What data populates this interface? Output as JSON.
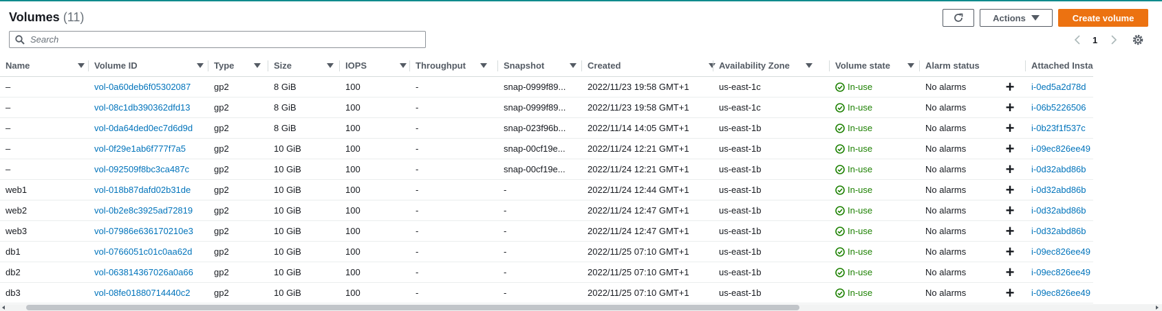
{
  "header": {
    "title": "Volumes",
    "count": "(11)"
  },
  "toolbar": {
    "actions_label": "Actions",
    "create_label": "Create volume"
  },
  "search": {
    "placeholder": "Search",
    "value": ""
  },
  "pagination": {
    "page": "1"
  },
  "table": {
    "columns": [
      "Name",
      "Volume ID",
      "Type",
      "Size",
      "IOPS",
      "Throughput",
      "Snapshot",
      "Created",
      "Availability Zone",
      "Volume state",
      "Alarm status",
      "Attached Insta"
    ],
    "rows": [
      {
        "name": "–",
        "volume_id": "vol-0a60deb6f05302087",
        "type": "gp2",
        "size": "8 GiB",
        "iops": "100",
        "throughput": "-",
        "snapshot": "snap-0999f89...",
        "created": "2022/11/23 19:58 GMT+1",
        "az": "us-east-1c",
        "state": "In-use",
        "alarm": "No alarms",
        "attached": "i-0ed5a2d78d"
      },
      {
        "name": "–",
        "volume_id": "vol-08c1db390362dfd13",
        "type": "gp2",
        "size": "8 GiB",
        "iops": "100",
        "throughput": "-",
        "snapshot": "snap-0999f89...",
        "created": "2022/11/23 19:58 GMT+1",
        "az": "us-east-1c",
        "state": "In-use",
        "alarm": "No alarms",
        "attached": "i-06b5226506"
      },
      {
        "name": "–",
        "volume_id": "vol-0da64ded0ec7d6d9d",
        "type": "gp2",
        "size": "8 GiB",
        "iops": "100",
        "throughput": "-",
        "snapshot": "snap-023f96b...",
        "created": "2022/11/14 14:05 GMT+1",
        "az": "us-east-1b",
        "state": "In-use",
        "alarm": "No alarms",
        "attached": "i-0b23f1f537c"
      },
      {
        "name": "–",
        "volume_id": "vol-0f29e1ab6f777f7a5",
        "type": "gp2",
        "size": "10 GiB",
        "iops": "100",
        "throughput": "-",
        "snapshot": "snap-00cf19e...",
        "created": "2022/11/24 12:21 GMT+1",
        "az": "us-east-1b",
        "state": "In-use",
        "alarm": "No alarms",
        "attached": "i-09ec826ee49"
      },
      {
        "name": "–",
        "volume_id": "vol-092509f8bc3ca487c",
        "type": "gp2",
        "size": "10 GiB",
        "iops": "100",
        "throughput": "-",
        "snapshot": "snap-00cf19e...",
        "created": "2022/11/24 12:21 GMT+1",
        "az": "us-east-1b",
        "state": "In-use",
        "alarm": "No alarms",
        "attached": "i-0d32abd86b"
      },
      {
        "name": "web1",
        "volume_id": "vol-018b87dafd02b31de",
        "type": "gp2",
        "size": "10 GiB",
        "iops": "100",
        "throughput": "-",
        "snapshot": "-",
        "created": "2022/11/24 12:44 GMT+1",
        "az": "us-east-1b",
        "state": "In-use",
        "alarm": "No alarms",
        "attached": "i-0d32abd86b"
      },
      {
        "name": "web2",
        "volume_id": "vol-0b2e8c3925ad72819",
        "type": "gp2",
        "size": "10 GiB",
        "iops": "100",
        "throughput": "-",
        "snapshot": "-",
        "created": "2022/11/24 12:47 GMT+1",
        "az": "us-east-1b",
        "state": "In-use",
        "alarm": "No alarms",
        "attached": "i-0d32abd86b"
      },
      {
        "name": "web3",
        "volume_id": "vol-07986e636170210e3",
        "type": "gp2",
        "size": "10 GiB",
        "iops": "100",
        "throughput": "-",
        "snapshot": "-",
        "created": "2022/11/24 12:47 GMT+1",
        "az": "us-east-1b",
        "state": "In-use",
        "alarm": "No alarms",
        "attached": "i-0d32abd86b"
      },
      {
        "name": "db1",
        "volume_id": "vol-0766051c01c0aa62d",
        "type": "gp2",
        "size": "10 GiB",
        "iops": "100",
        "throughput": "-",
        "snapshot": "-",
        "created": "2022/11/25 07:10 GMT+1",
        "az": "us-east-1b",
        "state": "In-use",
        "alarm": "No alarms",
        "attached": "i-09ec826ee49"
      },
      {
        "name": "db2",
        "volume_id": "vol-063814367026a0a66",
        "type": "gp2",
        "size": "10 GiB",
        "iops": "100",
        "throughput": "-",
        "snapshot": "-",
        "created": "2022/11/25 07:10 GMT+1",
        "az": "us-east-1b",
        "state": "In-use",
        "alarm": "No alarms",
        "attached": "i-09ec826ee49"
      },
      {
        "name": "db3",
        "volume_id": "vol-08fe01880714440c2",
        "type": "gp2",
        "size": "10 GiB",
        "iops": "100",
        "throughput": "-",
        "snapshot": "-",
        "created": "2022/11/25 07:10 GMT+1",
        "az": "us-east-1b",
        "state": "In-use",
        "alarm": "No alarms",
        "attached": "i-09ec826ee49"
      }
    ]
  },
  "icons": {
    "refresh": "refresh-icon",
    "caret": "caret-down-icon",
    "search": "search-icon",
    "prev": "chevron-left-icon",
    "next": "chevron-right-icon",
    "settings": "gear-icon",
    "sort": "sort-caret-icon",
    "status_ok": "check-circle-icon",
    "add": "plus-icon"
  },
  "colors": {
    "accent": "#ec7211",
    "link": "#0073bb",
    "success": "#1d8102",
    "top_bar": "#0f8b8d"
  }
}
